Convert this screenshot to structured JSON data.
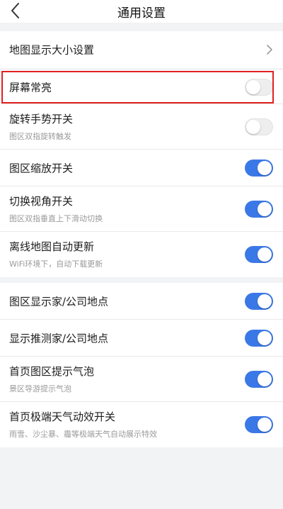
{
  "header": {
    "title": "通用设置",
    "back_icon": "chevron-left-icon"
  },
  "colors": {
    "accent": "#3b78e7",
    "highlight": "#e02020"
  },
  "group1": {
    "map_size": {
      "label": "地图显示大小设置",
      "icon": "chevron-right-icon"
    }
  },
  "group2": {
    "items": [
      {
        "label": "屏幕常亮",
        "sublabel": "",
        "on": false,
        "highlighted": true
      },
      {
        "label": "旋转手势开关",
        "sublabel": "图区双指旋转触发",
        "on": false
      },
      {
        "label": "图区缩放开关",
        "sublabel": "",
        "on": true
      },
      {
        "label": "切换视角开关",
        "sublabel": "图区双指垂直上下滑动切换",
        "on": true
      },
      {
        "label": "离线地图自动更新",
        "sublabel": "WiFi环境下，自动下载更新",
        "on": true
      }
    ]
  },
  "group3": {
    "items": [
      {
        "label": "图区显示家/公司地点",
        "sublabel": "",
        "on": true
      },
      {
        "label": "显示推测家/公司地点",
        "sublabel": "",
        "on": true
      },
      {
        "label": "首页图区提示气泡",
        "sublabel": "景区导游提示气泡",
        "on": true
      },
      {
        "label": "首页极端天气动效开关",
        "sublabel": "雨雪、沙尘暴、霾等极端天气自动展示特效",
        "on": true
      }
    ]
  }
}
